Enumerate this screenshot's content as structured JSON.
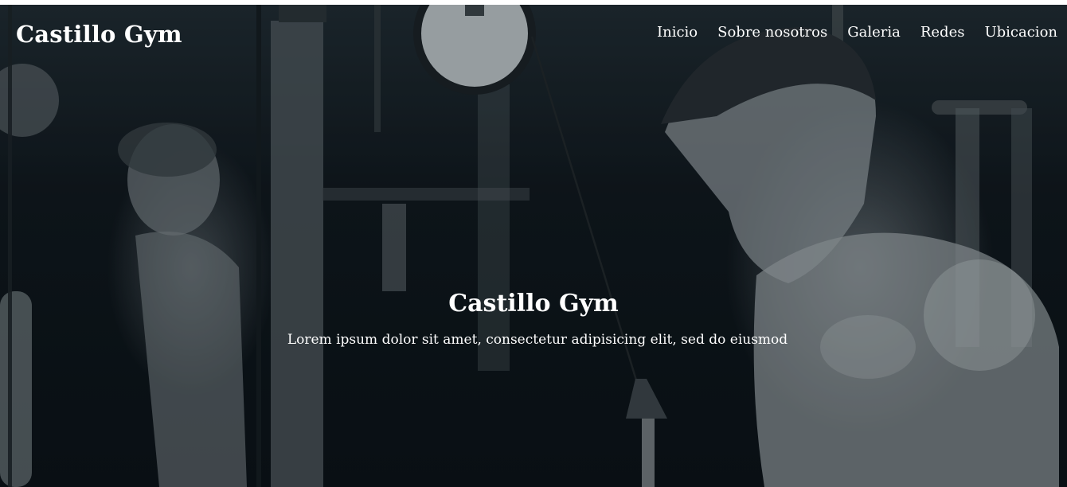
{
  "header": {
    "brand": "Castillo Gym",
    "nav": [
      {
        "label": "Inicio"
      },
      {
        "label": "Sobre nosotros"
      },
      {
        "label": "Galeria"
      },
      {
        "label": "Redes"
      },
      {
        "label": "Ubicacion"
      }
    ]
  },
  "hero": {
    "title": "Castillo Gym",
    "subtitle": "Lorem ipsum dolor sit amet, consectetur adipisicing elit, sed do eiusmod"
  }
}
